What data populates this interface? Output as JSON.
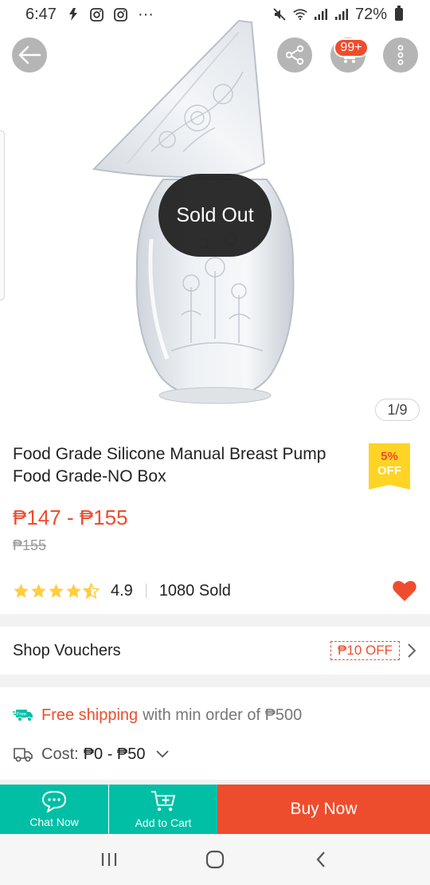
{
  "status_bar": {
    "time": "6:47",
    "overflow": "···",
    "battery": "72%"
  },
  "hero": {
    "sold_out_label": "Sold Out",
    "image_counter": "1/9",
    "cart_badge": "99+"
  },
  "product": {
    "title_line1": "Food Grade Silicone Manual Breast Pump",
    "title_line2": "Food Grade-NO Box",
    "discount_percent": "5%",
    "discount_off": "OFF",
    "price_range": "₱147 - ₱155",
    "original_price": "₱155",
    "rating": "4.9",
    "rating_stars": 4.5,
    "sold_count": "1080 Sold",
    "favorited": true
  },
  "vouchers": {
    "label": "Shop Vouchers",
    "chip": "₱10 OFF"
  },
  "shipping": {
    "highlight": "Free shipping",
    "rest": "with min order of ₱500",
    "cost_label": "Cost:",
    "cost_value": "₱0 - ₱50",
    "free_badge": "Free"
  },
  "actions": {
    "chat_label": "Chat Now",
    "add_to_cart_label": "Add to Cart",
    "buy_now_label": "Buy Now"
  },
  "colors": {
    "accent": "#ee4d2d",
    "teal": "#00bfa5",
    "star": "#ffce3d",
    "discount_bg": "#ffd424"
  }
}
